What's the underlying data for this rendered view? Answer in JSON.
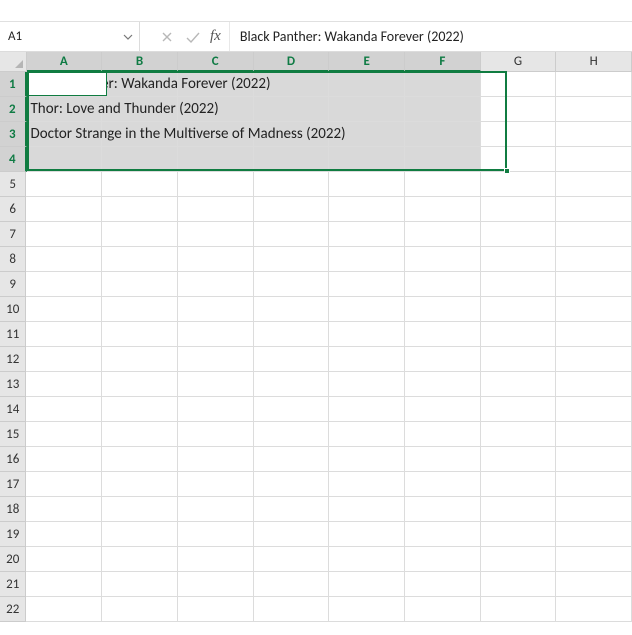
{
  "namebox": {
    "value": "A1"
  },
  "formula_bar": {
    "fx_label": "fx",
    "value": "Black Panther: Wakanda Forever (2022)"
  },
  "columns": [
    "A",
    "B",
    "C",
    "D",
    "E",
    "F",
    "G",
    "H"
  ],
  "selected_cols": [
    "A",
    "B",
    "C",
    "D",
    "E",
    "F"
  ],
  "rows": [
    1,
    2,
    3,
    4,
    5,
    6,
    7,
    8,
    9,
    10,
    11,
    12,
    13,
    14,
    15,
    16,
    17,
    18,
    19,
    20,
    21,
    22
  ],
  "selected_rows": [
    1,
    2,
    3,
    4
  ],
  "cells": {
    "A1": "Black Panther: Wakanda Forever (2022)",
    "A2": "Thor: Love and Thunder (2022)",
    "A3": "Doctor Strange in the Multiverse of Madness (2022)"
  },
  "selection": {
    "start": "A1",
    "end": "F4"
  },
  "active_cell": "A1"
}
